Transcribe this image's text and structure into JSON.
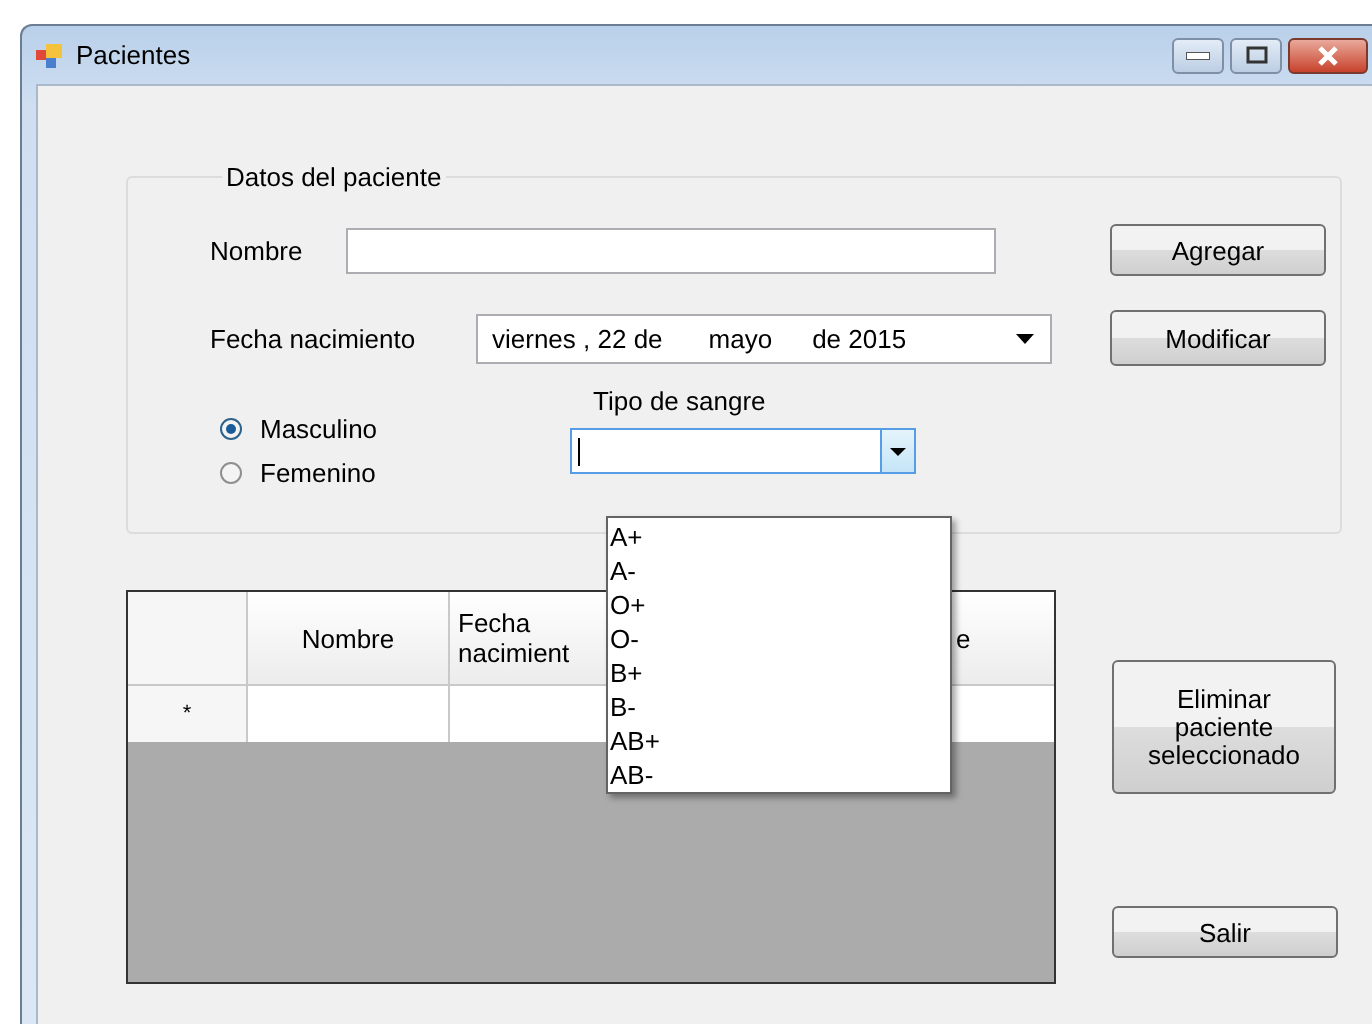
{
  "window": {
    "title": "Pacientes"
  },
  "group": {
    "title": "Datos del paciente"
  },
  "nombre": {
    "label": "Nombre"
  },
  "fecha": {
    "label": "Fecha nacimiento",
    "parts": [
      "viernes , 22 de",
      "mayo",
      "de 2015"
    ]
  },
  "sexo": [
    {
      "label": "Masculino",
      "selected": true
    },
    {
      "label": "Femenino",
      "selected": false
    }
  ],
  "tipo_sangre": {
    "label": "Tipo de sangre",
    "expanded": true,
    "options": [
      "A+",
      "A-",
      "O+",
      "O-",
      "B+",
      "B-",
      "AB+",
      "AB-"
    ]
  },
  "group_buttons": [
    "Agregar",
    "Modificar"
  ],
  "table": {
    "columns": [
      "Nombre",
      "Fecha nacimient",
      "e"
    ],
    "new_row_marker": "*"
  },
  "buttons": [
    "Eliminar paciente seleccionado",
    "Salir"
  ]
}
